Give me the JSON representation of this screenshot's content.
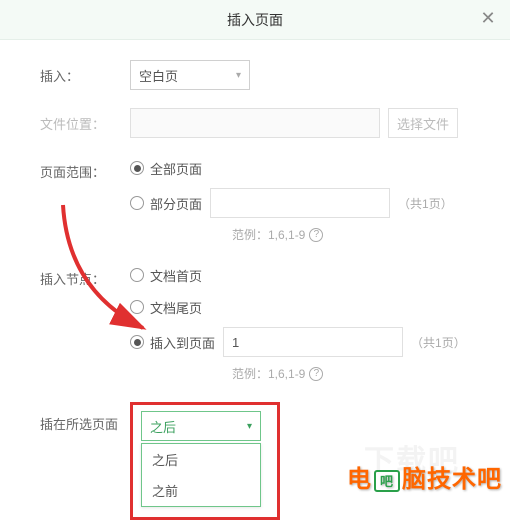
{
  "dialog": {
    "title": "插入页面",
    "close_icon": "✕"
  },
  "insert": {
    "label": "插入：",
    "value": "空白页"
  },
  "file_location": {
    "label": "文件位置：",
    "value": "",
    "browse": "选择文件"
  },
  "page_range": {
    "label": "页面范围：",
    "all": "全部页面",
    "partial": "部分页面",
    "input_value": "",
    "total_hint": "（共1页）",
    "example": "范例：1,6,1-9",
    "selected": "all"
  },
  "insert_point": {
    "label": "插入节点：",
    "first": "文档首页",
    "last": "文档尾页",
    "to_page": "插入到页面",
    "page_value": "1",
    "total_hint": "（共1页）",
    "example": "范例：1,6,1-9",
    "selected": "to_page"
  },
  "position": {
    "label": "插在所选页面",
    "value": "之后",
    "options": [
      "之后",
      "之前"
    ]
  },
  "watermark": {
    "text_before": "电",
    "logo": "吧",
    "text_after": "脑技术吧",
    "faint": "下载吧"
  }
}
